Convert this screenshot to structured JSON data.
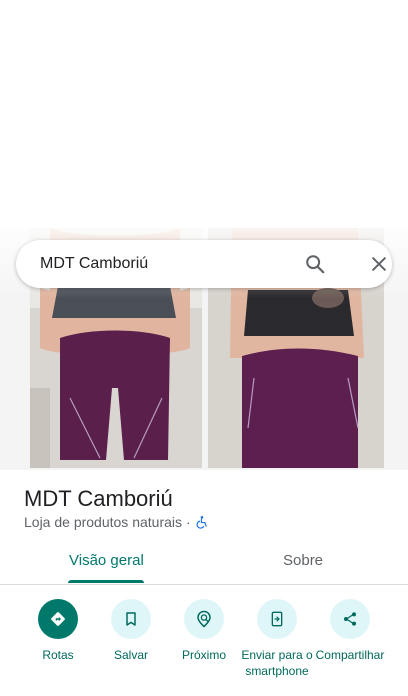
{
  "search": {
    "query": "MDT Camboriú"
  },
  "place": {
    "title": "MDT Camboriú",
    "category": "Loja de produtos naturais",
    "separator": "·"
  },
  "tabs": [
    {
      "label": "Visão geral",
      "active": true
    },
    {
      "label": "Sobre",
      "active": false
    }
  ],
  "actions": [
    {
      "label": "Rotas",
      "icon": "directions-icon"
    },
    {
      "label": "Salvar",
      "icon": "bookmark-icon"
    },
    {
      "label": "Próximo",
      "icon": "nearby-icon"
    },
    {
      "label": "Enviar para o smartphone",
      "icon": "send-to-phone-icon"
    },
    {
      "label": "Compartilhar",
      "icon": "share-icon"
    }
  ],
  "colors": {
    "accent": "#00796b",
    "action_bg": "#dff6f9",
    "title": "#202124",
    "muted": "#5f6368"
  }
}
